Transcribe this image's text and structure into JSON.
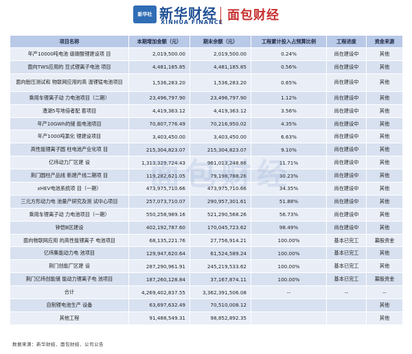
{
  "header": {
    "logo_badge": "新华社",
    "brand_cn": "新华财经",
    "brand_en": "XINHUA FINANCE",
    "brand2": "面包财经"
  },
  "watermark": "面包财经",
  "table": {
    "columns": [
      "项目名称",
      "本期增加金额（元）",
      "期末余额（元）",
      "工程累计投入占预算比例",
      "工程进度",
      "资金来源"
    ],
    "rows": [
      {
        "name": "年产10000吨电池 级碳酸锂建设项 目",
        "increase": "2,019,500.00",
        "balance": "2,019,500.00",
        "ratio": "0.24%",
        "progress": "尚在建设中",
        "source": "其他"
      },
      {
        "name": "面向TWS应用的 豆式锂离子电池 项目",
        "increase": "4,481,185.85",
        "balance": "4,481,185.85",
        "ratio": "0.56%",
        "progress": "尚在建设中",
        "source": "其他"
      },
      {
        "name": "面向胎压测试和 物联网应用的高 温锂锰电池项目",
        "increase": "1,536,283.20",
        "balance": "1,536,283.20",
        "ratio": "0.65%",
        "progress": "尚在建设中",
        "source": "其他",
        "tall": true
      },
      {
        "name": "乘用车锂离子动 力电池项目（二期）",
        "increase": "23,496,797.90",
        "balance": "23,496,797.90",
        "ratio": "1.12%",
        "progress": "尚在建设中",
        "source": "其他"
      },
      {
        "name": "澧湖5号地倍者配 套项目",
        "increase": "4,419,363.12",
        "balance": "4,419,363.12",
        "ratio": "3.56%",
        "progress": "尚在建设中",
        "source": "其他"
      },
      {
        "name": "年产10GWh的储 能电池项目",
        "increase": "70,807,776.49",
        "balance": "70,216,950.02",
        "ratio": "4.35%",
        "progress": "尚在建设中",
        "source": "其他"
      },
      {
        "name": "年产1000吨氯化 锂建设项目",
        "increase": "3,403,450.00",
        "balance": "3,403,450.00",
        "ratio": "6.63%",
        "progress": "尚在建设中",
        "source": "其他"
      },
      {
        "name": "高性能锂离子圆 柱电池产业化项 目",
        "increase": "215,304,823.07",
        "balance": "215,304,823.07",
        "ratio": "9.10%",
        "progress": "尚在建设中",
        "source": "其他"
      },
      {
        "name": "亿纬动力厂区建 设",
        "increase": "1,313,329,724.43",
        "balance": "961,013,248.86",
        "ratio": "11.71%",
        "progress": "尚在建设中",
        "source": "其他"
      },
      {
        "name": "荆门圆柱产品线 新建产线二期项 目",
        "increase": "119,282,621.05",
        "balance": "79,198,788.26",
        "ratio": "30.23%",
        "progress": "尚在建设中",
        "source": "其他"
      },
      {
        "name": "xHEV电池系统项 目（一期）",
        "increase": "473,975,710.66",
        "balance": "473,975,710.66",
        "ratio": "34.35%",
        "progress": "尚在建设中",
        "source": "其他"
      },
      {
        "name": "三元方形动力电 池量产研究及测 试中心项目",
        "increase": "257,073,710.07",
        "balance": "290,957,301.61",
        "ratio": "51.88%",
        "progress": "尚在建设中",
        "source": "其他"
      },
      {
        "name": "乘用车锂离子动 力电池项目（一期）",
        "increase": "550,258,989.16",
        "balance": "521,290,568.26",
        "ratio": "56.73%",
        "progress": "尚在建设中",
        "source": "其他"
      },
      {
        "name": "钟恺B区建设",
        "increase": "402,192,787.60",
        "balance": "170,045,723.62",
        "ratio": "98.49%",
        "progress": "尚在建设中",
        "source": "其他"
      },
      {
        "name": "面向物联网应用 的高性能锂离子 电池项目",
        "increase": "68,135,221.76",
        "balance": "27,756,914.21",
        "ratio": "100.00%",
        "progress": "基本已完工",
        "source": "募股资金"
      },
      {
        "name": "亿纬集能动力电 池项目",
        "increase": "129,947,620.64",
        "balance": "61,524,589.24",
        "ratio": "100.00%",
        "progress": "基本已完工",
        "source": "其他"
      },
      {
        "name": "荆门创能厂区建 设",
        "increase": "287,290,961.91",
        "balance": "245,219,533.62",
        "ratio": "100.00%",
        "progress": "基本已完工",
        "source": "其他"
      },
      {
        "name": "荆门亿纬创能储 能动力锂离子电 池项目",
        "increase": "187,260,128.84",
        "balance": "37,167,874.11",
        "ratio": "100.00%",
        "progress": "基本已完工",
        "source": "募股资金"
      },
      {
        "name": "合计",
        "increase": "4,269,402,837.55",
        "balance": "3,362,391,506.08",
        "ratio": "--",
        "progress": "--",
        "source": "--"
      },
      {
        "name": "自制锂电池生产 设备",
        "increase": "63,697,632.49",
        "balance": "70,510,008.12",
        "ratio": "",
        "progress": "",
        "source": "其他"
      },
      {
        "name": "其他工程",
        "increase": "91,488,549.31",
        "balance": "98,852,892.35",
        "ratio": "",
        "progress": "",
        "source": "其他"
      }
    ]
  },
  "footnote": "数据来源：新华财经、面包财经、公司公告"
}
